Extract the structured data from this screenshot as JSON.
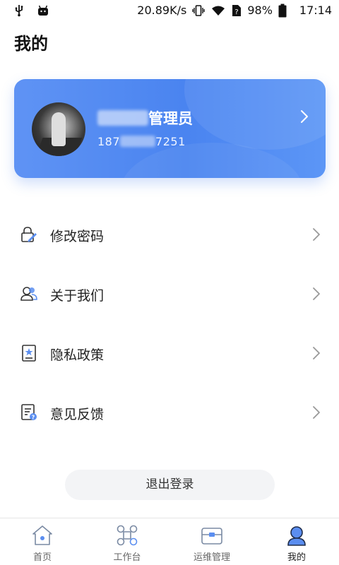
{
  "status_bar": {
    "speed": "20.89K/s",
    "battery": "98%",
    "time": "17:14",
    "icons": [
      "usb-icon",
      "android-icon",
      "vibrate-icon",
      "wifi-icon",
      "no-sim-icon",
      "battery-icon"
    ]
  },
  "page": {
    "title": "我的"
  },
  "profile": {
    "name_visible": "管理员",
    "phone_prefix": "187",
    "phone_suffix": "7251",
    "accent_color": "#4a84f0"
  },
  "menu": {
    "items": [
      {
        "label": "修改密码",
        "icon": "edit-lock-icon"
      },
      {
        "label": "关于我们",
        "icon": "users-icon"
      },
      {
        "label": "隐私政策",
        "icon": "privacy-doc-icon"
      },
      {
        "label": "意见反馈",
        "icon": "feedback-icon"
      }
    ]
  },
  "logout": {
    "label": "退出登录"
  },
  "bottom_nav": {
    "items": [
      {
        "label": "首页",
        "icon": "home-icon"
      },
      {
        "label": "工作台",
        "icon": "workbench-icon"
      },
      {
        "label": "运维管理",
        "icon": "ops-icon"
      },
      {
        "label": "我的",
        "icon": "profile-icon",
        "active": true
      }
    ]
  }
}
